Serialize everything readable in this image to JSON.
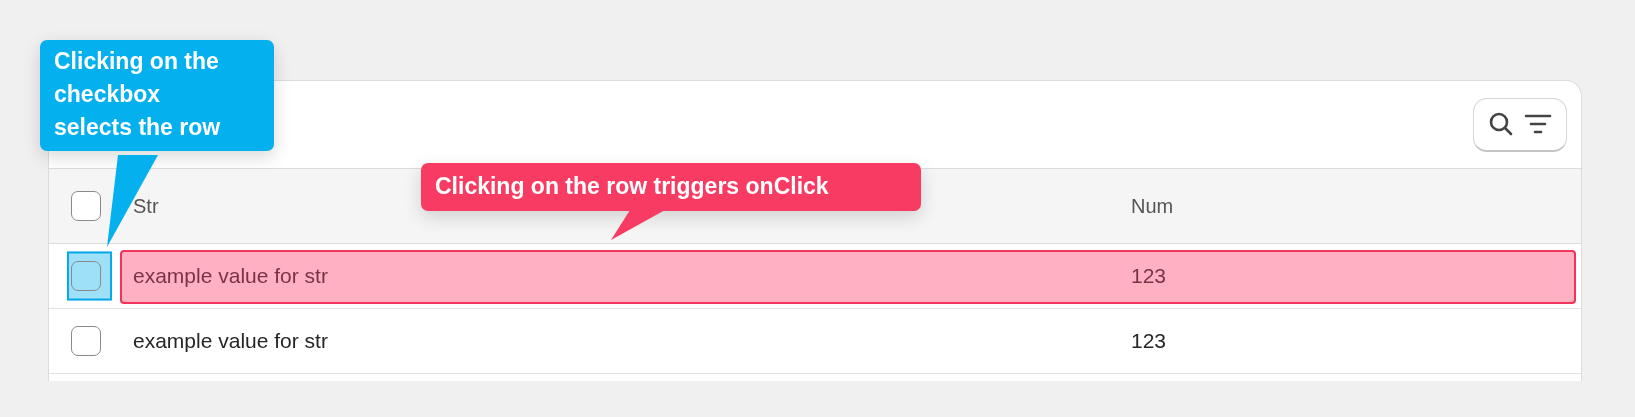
{
  "table": {
    "columns": [
      "Str",
      "Num"
    ],
    "header_checkbox": {
      "checked": false
    },
    "rows": [
      {
        "cells": [
          "example value for str",
          "123"
        ],
        "checked": false,
        "highlighted": true
      },
      {
        "cells": [
          "example value for str",
          "123"
        ],
        "checked": false,
        "highlighted": false
      }
    ]
  },
  "annotations": [
    {
      "kind": "checkbox",
      "text": "Clicking on the checkbox selects the row",
      "color": "#04b0ee"
    },
    {
      "kind": "row",
      "text": "Clicking on the row triggers onClick",
      "color": "#f83b62"
    }
  ]
}
